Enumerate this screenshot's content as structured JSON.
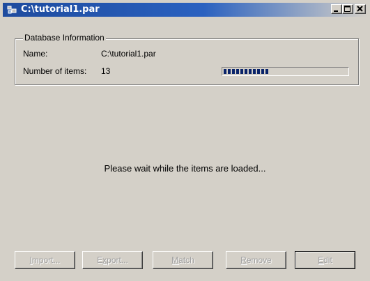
{
  "window": {
    "title": "C:\\tutorial1.par",
    "colors": {
      "titlebar_start": "#1e4b9e",
      "titlebar_end": "#d4d0c8",
      "face": "#d4d0c8"
    }
  },
  "database_info": {
    "group_label": "Database Information",
    "name_label": "Name:",
    "name_value": "C:\\tutorial1.par",
    "items_label": "Number of items:",
    "items_value": "13",
    "progress_fraction": 0.4
  },
  "status": {
    "message": "Please wait while the items are loaded..."
  },
  "buttons": {
    "import": {
      "mnemonic": "I",
      "rest": "mport..."
    },
    "export": {
      "pre": "E",
      "mnemonic": "x",
      "rest": "port..."
    },
    "match": {
      "mnemonic": "M",
      "rest": "atch"
    },
    "remove": {
      "mnemonic": "R",
      "rest": "emove"
    },
    "edit": {
      "mnemonic": "E",
      "rest": "dit"
    }
  },
  "icons": {
    "app": "database-app-icon",
    "minimize": "minimize-icon",
    "maximize": "maximize-icon",
    "close": "close-icon"
  }
}
